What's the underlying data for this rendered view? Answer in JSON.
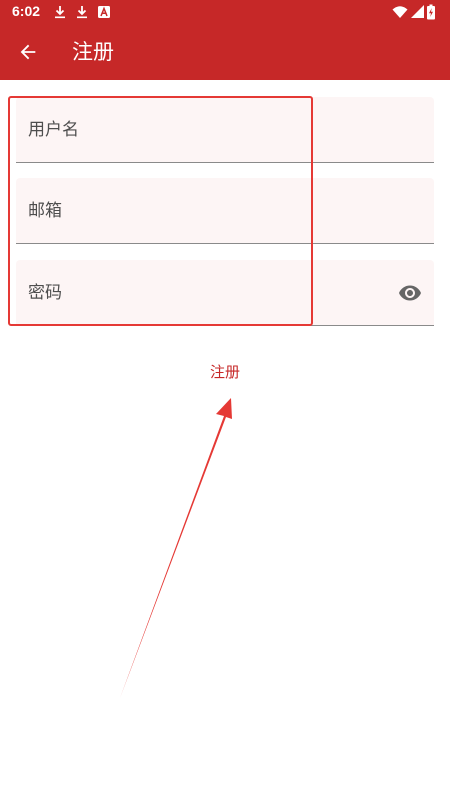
{
  "status_bar": {
    "time": "6:02",
    "icons": [
      "download-icon",
      "download-icon",
      "app-notification-icon",
      "wifi-icon",
      "signal-icon",
      "battery-charging-icon"
    ]
  },
  "app_bar": {
    "title": "注册",
    "back_icon": "arrow-left-icon"
  },
  "form": {
    "username": {
      "label": "用户名",
      "value": ""
    },
    "email": {
      "label": "邮箱",
      "value": ""
    },
    "password": {
      "label": "密码",
      "value": "",
      "toggle_icon": "eye-icon"
    }
  },
  "register_button": {
    "label": "注册"
  },
  "colors": {
    "primary": "#c62828",
    "field_bg": "#fdf5f5",
    "annotation": "#e53935"
  }
}
